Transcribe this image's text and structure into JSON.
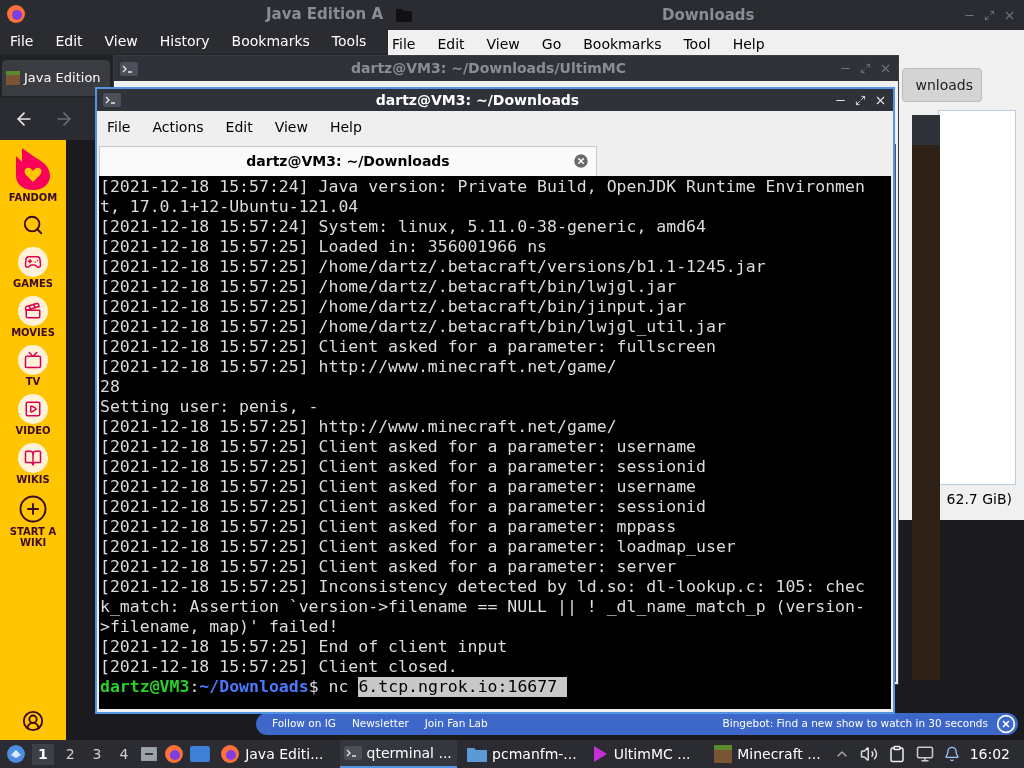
{
  "firefox": {
    "title": "Java Edition A",
    "menu": [
      "File",
      "Edit",
      "View",
      "History",
      "Bookmarks",
      "Tools"
    ],
    "tab": {
      "label": "Java Edition"
    }
  },
  "fandom_sidebar": {
    "items": [
      {
        "kind": "logo",
        "label": "FANDOM"
      },
      {
        "kind": "search"
      },
      {
        "kind": "games",
        "label": "GAMES"
      },
      {
        "kind": "movies",
        "label": "MOVIES"
      },
      {
        "kind": "tv",
        "label": "TV"
      },
      {
        "kind": "video",
        "label": "VIDEO"
      },
      {
        "kind": "wikis",
        "label": "WIKIS"
      },
      {
        "kind": "create",
        "label": "START A WIKI"
      },
      {
        "kind": "account"
      }
    ]
  },
  "fandom_footer": {
    "links": [
      "Follow on IG",
      "Newsletter",
      "Join Fan Lab"
    ],
    "message": "Bingebot: Find a new show to watch in 30 seconds"
  },
  "file_manager": {
    "title": "Downloads",
    "menu": [
      "File",
      "Edit",
      "View",
      "Go",
      "Bookmarks",
      "Tool",
      "Help"
    ],
    "path_button": "wnloads",
    "status": "62.7 GiB)"
  },
  "back_terminal": {
    "title": "dartz@VM3: ~/Downloads/UltimMC"
  },
  "terminal": {
    "title": "dartz@VM3: ~/Downloads",
    "menu": [
      "File",
      "Actions",
      "Edit",
      "View",
      "Help"
    ],
    "tab": {
      "label": "dartz@VM3: ~/Downloads"
    },
    "lines": [
      "[2021-12-18 15:57:24] Java version: Private Build, OpenJDK Runtime Environmen",
      "t, 17.0.1+12-Ubuntu-121.04",
      "[2021-12-18 15:57:24] System: linux, 5.11.0-38-generic, amd64",
      "[2021-12-18 15:57:25] Loaded in: 356001966 ns",
      "[2021-12-18 15:57:25] /home/dartz/.betacraft/versions/b1.1-1245.jar",
      "[2021-12-18 15:57:25] /home/dartz/.betacraft/bin/lwjgl.jar",
      "[2021-12-18 15:57:25] /home/dartz/.betacraft/bin/jinput.jar",
      "[2021-12-18 15:57:25] /home/dartz/.betacraft/bin/lwjgl_util.jar",
      "[2021-12-18 15:57:25] Client asked for a parameter: fullscreen",
      "[2021-12-18 15:57:25] http://www.minecraft.net/game/",
      "28",
      "Setting user: penis, -",
      "[2021-12-18 15:57:25] http://www.minecraft.net/game/",
      "[2021-12-18 15:57:25] Client asked for a parameter: username",
      "[2021-12-18 15:57:25] Client asked for a parameter: sessionid",
      "[2021-12-18 15:57:25] Client asked for a parameter: username",
      "[2021-12-18 15:57:25] Client asked for a parameter: sessionid",
      "[2021-12-18 15:57:25] Client asked for a parameter: mppass",
      "[2021-12-18 15:57:25] Client asked for a parameter: loadmap_user",
      "[2021-12-18 15:57:25] Client asked for a parameter: server",
      "[2021-12-18 15:57:25] Inconsistency detected by ld.so: dl-lookup.c: 105: chec",
      "k_match: Assertion `version->filename == NULL || ! _dl_name_match_p (version-",
      ">filename, map)' failed!",
      "[2021-12-18 15:57:25] End of client input",
      "[2021-12-18 15:57:25] Client closed."
    ],
    "prompt": {
      "user": "dartz@VM3",
      "separator": ":",
      "path": "~/Downloads",
      "symbol": "$",
      "command": "nc",
      "selection": "6.tcp.ngrok.io:16677 "
    }
  },
  "taskbar": {
    "workspaces": [
      {
        "label": "1",
        "selected": true
      },
      {
        "label": "2",
        "selected": false
      },
      {
        "label": "3",
        "selected": false
      },
      {
        "label": "4",
        "selected": false
      }
    ],
    "tasks": [
      {
        "kind": "firefox",
        "label": "Java Editi...",
        "selected": false
      },
      {
        "kind": "terminal",
        "label": "qterminal ...",
        "selected": true
      },
      {
        "kind": "folder",
        "label": "pcmanfm-...",
        "selected": false
      },
      {
        "kind": "launcher",
        "label": "UltimMC ...",
        "selected": false
      },
      {
        "kind": "block",
        "label": "Minecraft ...",
        "selected": false
      }
    ],
    "clock": "16:02"
  }
}
